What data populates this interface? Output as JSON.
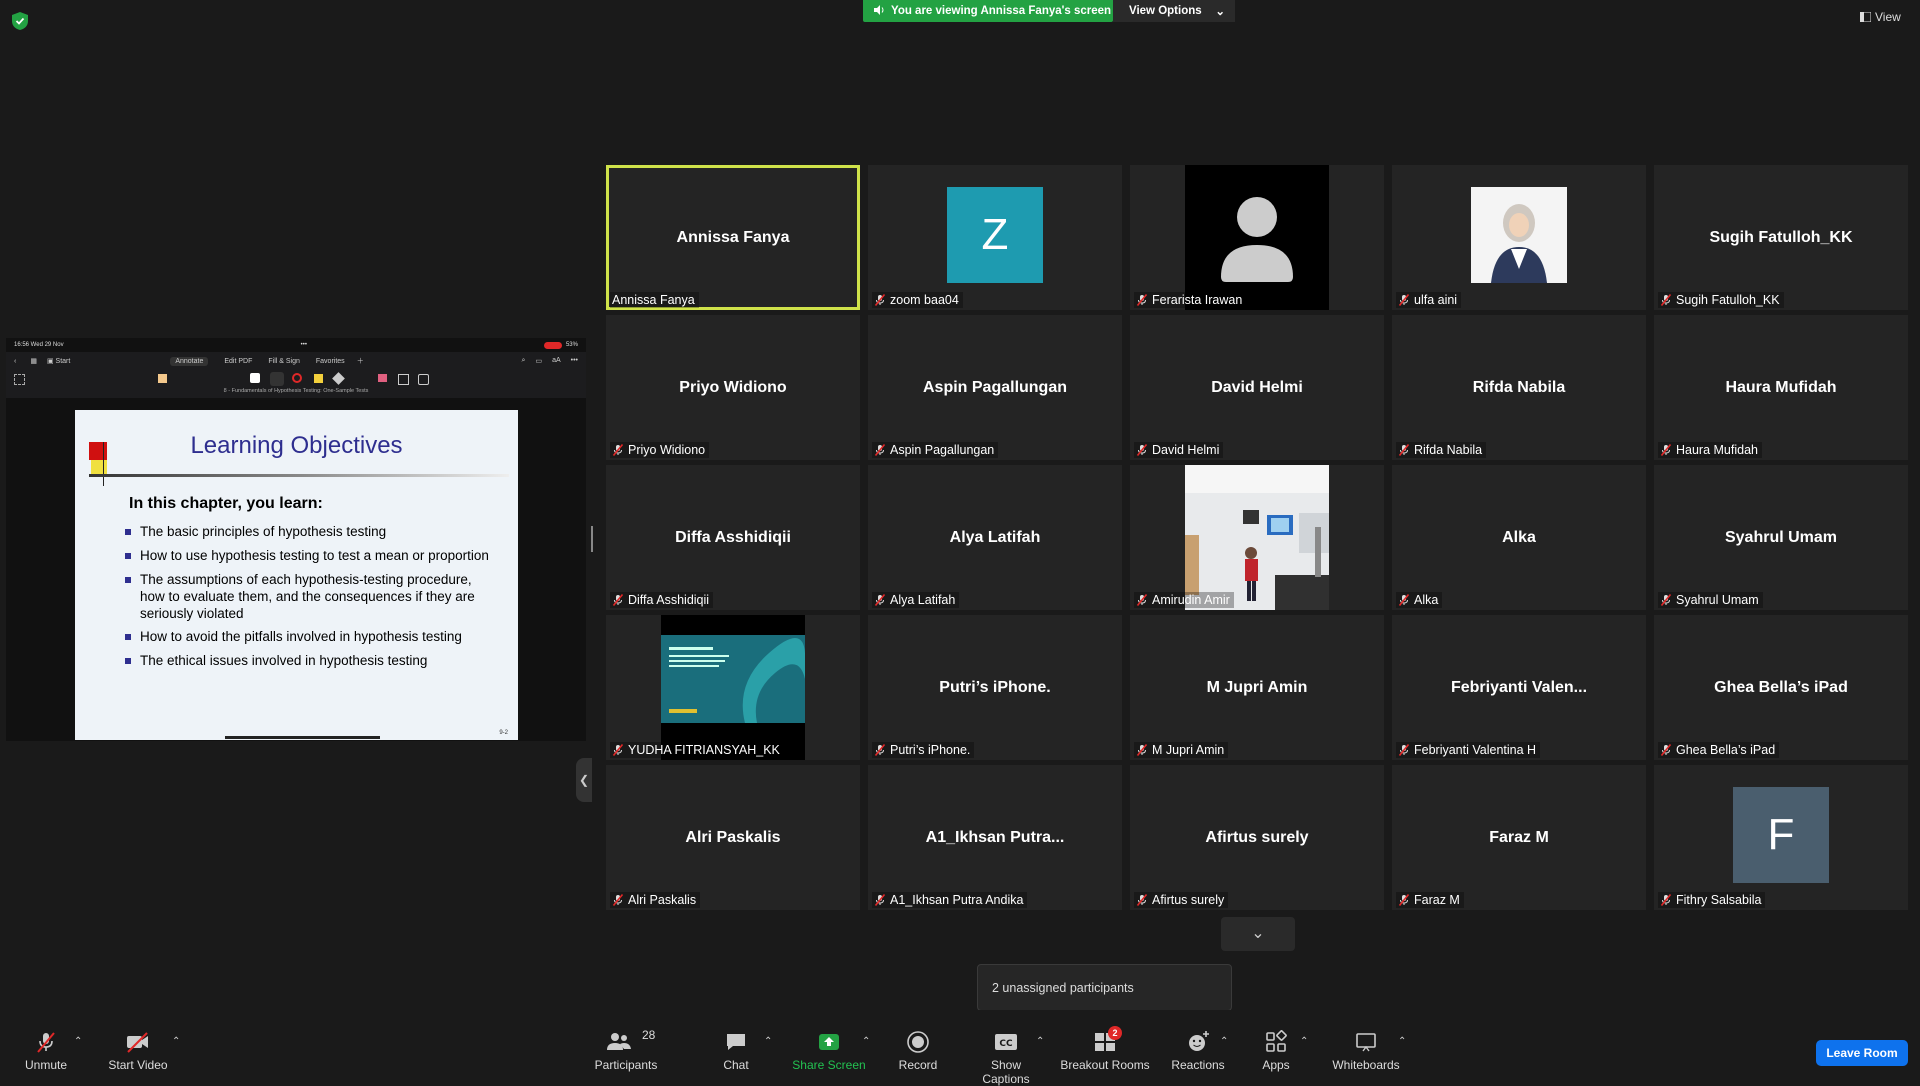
{
  "banner": {
    "text": "You are viewing Annissa Fanya's screen",
    "view_options": "View Options"
  },
  "view_button": "View",
  "shared": {
    "status_time": "16:56  Wed 29 Nov",
    "status_dots": "•••",
    "status_battery": "53%",
    "tabs": [
      "Annotate",
      "Edit PDF",
      "Fill & Sign",
      "Favorites"
    ],
    "start_label": "Start",
    "doc_title": "8 - Fundamentals of Hypothesis Testing: One-Sample Tests",
    "slide_title": "Learning Objectives",
    "slide_heading": "In this chapter, you learn:",
    "bullets": [
      "The basic principles of hypothesis testing",
      "How to use hypothesis testing to test a mean or proportion",
      "The assumptions of each hypothesis-testing procedure, how to evaluate them, and the consequences if they are seriously violated",
      "How to avoid the pitfalls involved in hypothesis testing",
      "The ethical issues involved in hypothesis testing"
    ],
    "slide_page": "9-2"
  },
  "tiles": [
    {
      "name": "Annissa Fanya",
      "label": "Annissa Fanya",
      "type": "name",
      "muted": false,
      "active": true
    },
    {
      "name": "",
      "label": "zoom baa04",
      "type": "letter",
      "letter": "Z",
      "color": "#1e9bb0",
      "muted": true
    },
    {
      "name": "",
      "label": "Ferarista Irawan",
      "type": "silhouette",
      "muted": true
    },
    {
      "name": "",
      "label": "ulfa aini",
      "type": "photo",
      "muted": true
    },
    {
      "name": "Sugih Fatulloh_KK",
      "label": "Sugih Fatulloh_KK",
      "type": "name",
      "muted": true
    },
    {
      "name": "Priyo Widiono",
      "label": "Priyo Widiono",
      "type": "name",
      "muted": true
    },
    {
      "name": "Aspin Pagallungan",
      "label": "Aspin Pagallungan",
      "type": "name",
      "muted": true
    },
    {
      "name": "David Helmi",
      "label": "David Helmi",
      "type": "name",
      "muted": true
    },
    {
      "name": "Rifda Nabila",
      "label": "Rifda Nabila",
      "type": "name",
      "muted": true
    },
    {
      "name": "Haura Mufidah",
      "label": "Haura Mufidah",
      "type": "name",
      "muted": true
    },
    {
      "name": "Diffa Asshidiqii",
      "label": "Diffa Asshidiqii",
      "type": "name",
      "muted": true
    },
    {
      "name": "Alya Latifah",
      "label": "Alya Latifah",
      "type": "name",
      "muted": true
    },
    {
      "name": "",
      "label": "Amirudin Amir",
      "type": "video",
      "muted": true
    },
    {
      "name": "Alka",
      "label": "Alka",
      "type": "name",
      "muted": true
    },
    {
      "name": "Syahrul Umam",
      "label": "Syahrul Umam",
      "type": "name",
      "muted": true
    },
    {
      "name": "",
      "label": "YUDHA FITRIANSYAH_KK",
      "type": "slidevideo",
      "muted": true
    },
    {
      "name": "Putri’s iPhone.",
      "label": "Putri’s iPhone.",
      "type": "name",
      "muted": true
    },
    {
      "name": "M Jupri Amin",
      "label": "M Jupri Amin",
      "type": "name",
      "muted": true
    },
    {
      "name": "Febriyanti  Valen...",
      "label": "Febriyanti Valentina H",
      "type": "name",
      "muted": true
    },
    {
      "name": "Ghea Bella’s iPad",
      "label": "Ghea Bella’s iPad",
      "type": "name",
      "muted": true
    },
    {
      "name": "Alri Paskalis",
      "label": "Alri Paskalis",
      "type": "name",
      "muted": true
    },
    {
      "name": "A1_Ikhsan  Putra...",
      "label": "A1_Ikhsan Putra Andika",
      "type": "name",
      "muted": true
    },
    {
      "name": "Afirtus surely",
      "label": "Afirtus surely",
      "type": "name",
      "muted": true
    },
    {
      "name": "Faraz M",
      "label": "Faraz M",
      "type": "name",
      "muted": true
    },
    {
      "name": "",
      "label": "Fithry Salsabila",
      "type": "letter",
      "letter": "F",
      "color": "#4a5e6e",
      "muted": true
    }
  ],
  "unassigned": "2 unassigned participants",
  "toolbar": {
    "unmute": "Unmute",
    "start_video": "Start Video",
    "participants": "Participants",
    "participants_count": "28",
    "chat": "Chat",
    "share_screen": "Share Screen",
    "record": "Record",
    "show_captions": "Show Captions",
    "breakout_rooms": "Breakout Rooms",
    "breakout_badge": "2",
    "reactions": "Reactions",
    "apps": "Apps",
    "whiteboards": "Whiteboards",
    "leave_room": "Leave Room"
  },
  "colors": {
    "active_border": "#cfe24a",
    "share_green": "#23a243",
    "leave_blue": "#0e72ed",
    "mute_red": "#e02828"
  }
}
